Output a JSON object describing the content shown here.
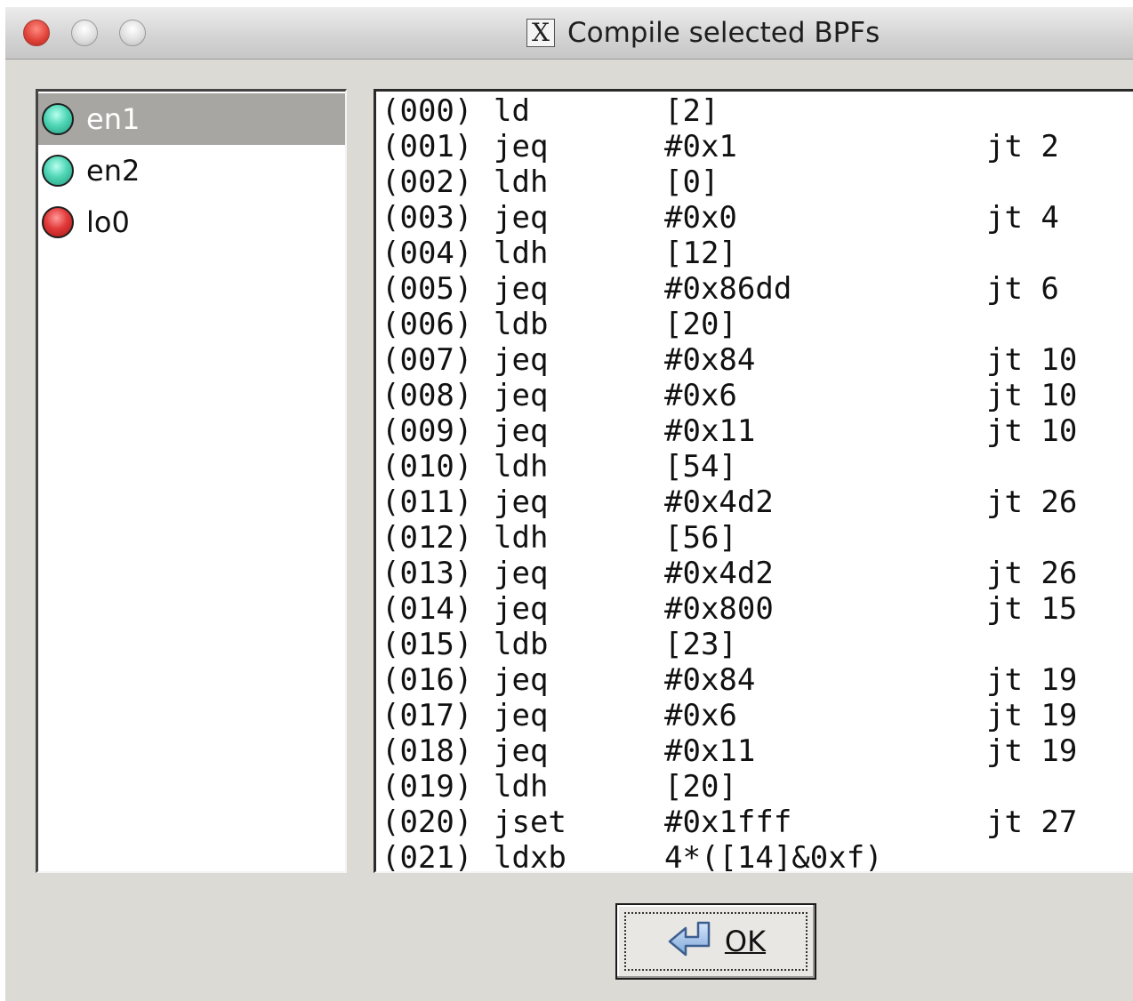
{
  "window": {
    "title": "Compile selected BPFs",
    "app_icon": "x11-icon"
  },
  "interfaces": [
    {
      "name": "en1",
      "status": "green",
      "selected": true
    },
    {
      "name": "en2",
      "status": "green",
      "selected": false
    },
    {
      "name": "lo0",
      "status": "red",
      "selected": false
    }
  ],
  "code": [
    {
      "idx": "(000)",
      "op": "ld",
      "arg": "[2]",
      "jt": ""
    },
    {
      "idx": "(001)",
      "op": "jeq",
      "arg": "#0x1",
      "jt": "jt 2"
    },
    {
      "idx": "(002)",
      "op": "ldh",
      "arg": "[0]",
      "jt": ""
    },
    {
      "idx": "(003)",
      "op": "jeq",
      "arg": "#0x0",
      "jt": "jt 4"
    },
    {
      "idx": "(004)",
      "op": "ldh",
      "arg": "[12]",
      "jt": ""
    },
    {
      "idx": "(005)",
      "op": "jeq",
      "arg": "#0x86dd",
      "jt": "jt 6"
    },
    {
      "idx": "(006)",
      "op": "ldb",
      "arg": "[20]",
      "jt": ""
    },
    {
      "idx": "(007)",
      "op": "jeq",
      "arg": "#0x84",
      "jt": "jt 10"
    },
    {
      "idx": "(008)",
      "op": "jeq",
      "arg": "#0x6",
      "jt": "jt 10"
    },
    {
      "idx": "(009)",
      "op": "jeq",
      "arg": "#0x11",
      "jt": "jt 10"
    },
    {
      "idx": "(010)",
      "op": "ldh",
      "arg": "[54]",
      "jt": ""
    },
    {
      "idx": "(011)",
      "op": "jeq",
      "arg": "#0x4d2",
      "jt": "jt 26"
    },
    {
      "idx": "(012)",
      "op": "ldh",
      "arg": "[56]",
      "jt": ""
    },
    {
      "idx": "(013)",
      "op": "jeq",
      "arg": "#0x4d2",
      "jt": "jt 26"
    },
    {
      "idx": "(014)",
      "op": "jeq",
      "arg": "#0x800",
      "jt": "jt 15"
    },
    {
      "idx": "(015)",
      "op": "ldb",
      "arg": "[23]",
      "jt": ""
    },
    {
      "idx": "(016)",
      "op": "jeq",
      "arg": "#0x84",
      "jt": "jt 19"
    },
    {
      "idx": "(017)",
      "op": "jeq",
      "arg": "#0x6",
      "jt": "jt 19"
    },
    {
      "idx": "(018)",
      "op": "jeq",
      "arg": "#0x11",
      "jt": "jt 19"
    },
    {
      "idx": "(019)",
      "op": "ldh",
      "arg": "[20]",
      "jt": ""
    },
    {
      "idx": "(020)",
      "op": "jset",
      "arg": "#0x1fff",
      "jt": "jt 27"
    },
    {
      "idx": "(021)",
      "op": "ldxb",
      "arg": "4*([14]&0xf)",
      "jt": ""
    }
  ],
  "ok_button": {
    "label": "OK",
    "icon": "enter-arrow-icon"
  }
}
